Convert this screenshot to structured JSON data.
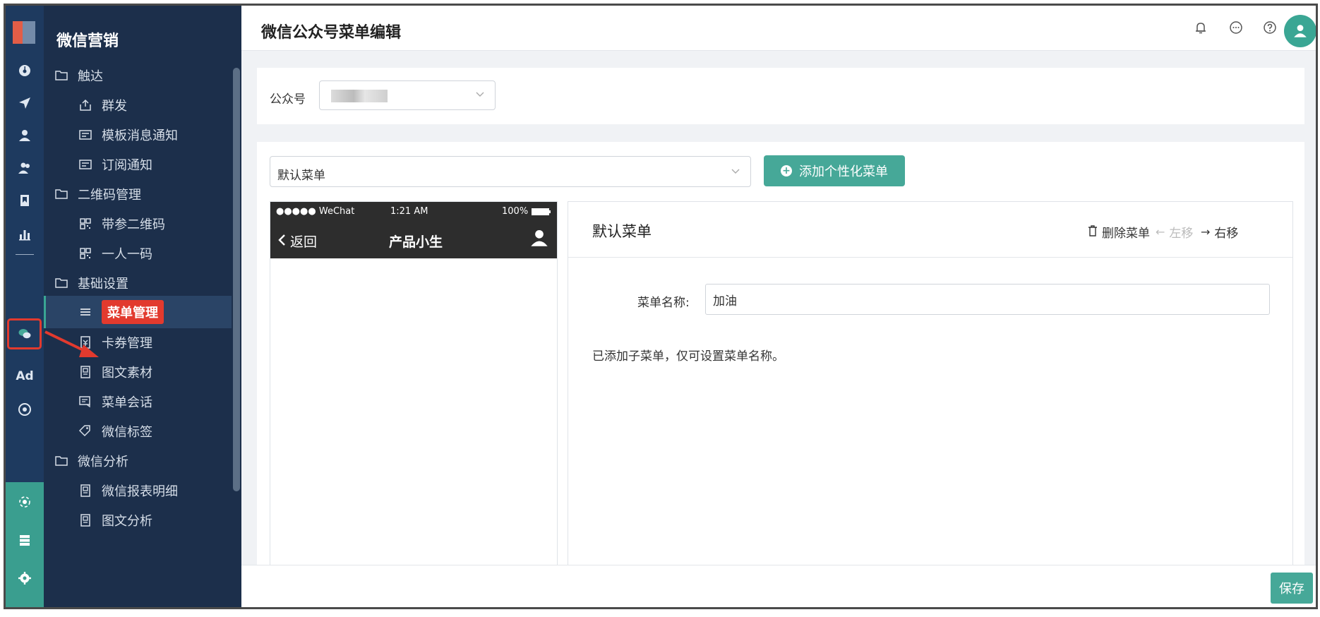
{
  "sidebar": {
    "brand": "微信营销",
    "items": [
      {
        "label": "触达",
        "icon": "folder-icon"
      },
      {
        "label": "群发",
        "icon": "broadcast-icon"
      },
      {
        "label": "模板消息通知",
        "icon": "template-icon"
      },
      {
        "label": "订阅通知",
        "icon": "subscribe-icon"
      },
      {
        "label": "二维码管理",
        "icon": "folder-icon"
      },
      {
        "label": "带参二维码",
        "icon": "qrcode-icon"
      },
      {
        "label": "一人一码",
        "icon": "qrcode-icon"
      },
      {
        "label": "基础设置",
        "icon": "folder-icon"
      },
      {
        "label": "菜单管理",
        "icon": "menu-icon"
      },
      {
        "label": "卡券管理",
        "icon": "coupon-icon"
      },
      {
        "label": "图文素材",
        "icon": "article-icon"
      },
      {
        "label": "菜单会话",
        "icon": "chat-icon"
      },
      {
        "label": "微信标签",
        "icon": "tag-icon"
      },
      {
        "label": "微信分析",
        "icon": "folder-icon"
      },
      {
        "label": "微信报表明细",
        "icon": "report-icon"
      },
      {
        "label": "图文分析",
        "icon": "report-icon"
      }
    ]
  },
  "rail": {
    "ad_label": "Ad"
  },
  "header": {
    "title": "微信公众号菜单编辑"
  },
  "account": {
    "label": "公众号"
  },
  "menu_select": {
    "value": "默认菜单"
  },
  "add_button": {
    "label": "添加个性化菜单"
  },
  "phone": {
    "carrier": "●●●●● WeChat",
    "time": "1:21 AM",
    "battery": "100%",
    "back": "返回",
    "title": "产品小生"
  },
  "editor": {
    "title": "默认菜单",
    "delete": "删除菜单",
    "move_left": "左移",
    "move_right": "右移",
    "name_label": "菜单名称:",
    "name_value": "加油",
    "hint": "已添加子菜单，仅可设置菜单名称。"
  },
  "footer": {
    "save": "保存"
  },
  "colors": {
    "rail": "#1e3a5f",
    "sidebar": "#1c2f4b",
    "accent": "#46a898",
    "highlight": "#e23a2e"
  }
}
